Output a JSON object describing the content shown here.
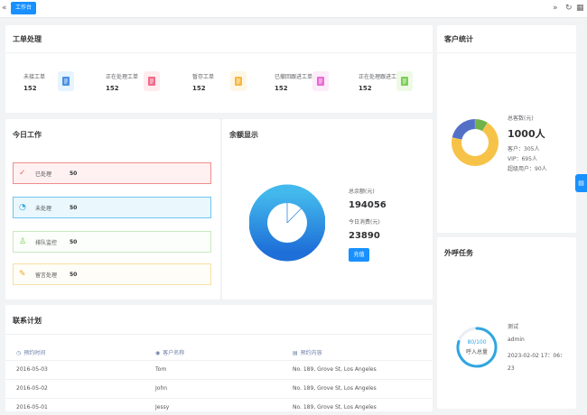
{
  "topbar": {
    "active_tab": "工作台"
  },
  "work_order": {
    "title": "工单处理",
    "items": [
      {
        "label": "未接工单",
        "value": "152",
        "color": "#4a90e2",
        "bg": "#e6f4ff"
      },
      {
        "label": "正在处理工单",
        "value": "152",
        "color": "#f06a8a",
        "bg": "#ffecef"
      },
      {
        "label": "暂存工单",
        "value": "152",
        "color": "#f5b942",
        "bg": "#fff7e6"
      },
      {
        "label": "已撤回跟进工单",
        "value": "152",
        "color": "#e86bd4",
        "bg": "#fdecfa"
      },
      {
        "label": "正在处理跟进工单",
        "value": "152",
        "color": "#7ccf55",
        "bg": "#eefae6"
      }
    ]
  },
  "customer_stats": {
    "title": "客户统计",
    "total_label": "总客数(元)",
    "total_value": "1000人",
    "lines": [
      "客户：305人",
      "VIP：695人",
      "超级用户：90人"
    ],
    "segments": [
      {
        "name": "超级用户",
        "fraction": 0.09,
        "color": "#6fb24a"
      },
      {
        "name": "VIP",
        "fraction": 0.695,
        "color": "#f7c248"
      },
      {
        "name": "客户",
        "fraction": 0.215,
        "color": "#5470c6"
      }
    ]
  },
  "today_work": {
    "title": "今日工作",
    "rows": [
      {
        "label": "已处理",
        "value": "50",
        "border": "#f08c8c",
        "bg": "#fff1f1",
        "icon": "✓",
        "icon_color": "#e06c6c"
      },
      {
        "label": "未处理",
        "value": "50",
        "border": "#6ec6f0",
        "bg": "#eaf7fd",
        "icon": "◔",
        "icon_color": "#2fa6e0"
      },
      {
        "label": "排队监控",
        "value": "50",
        "border": "#c9eac0",
        "bg": "#fbfefa",
        "icon": "♙",
        "icon_color": "#7ccf55"
      },
      {
        "label": "留言处理",
        "value": "50",
        "border": "#f7dfa4",
        "bg": "#fffdf7",
        "icon": "✎",
        "icon_color": "#f5a623"
      }
    ]
  },
  "balance": {
    "title": "余额显示",
    "total_label": "总余额(元)",
    "total_value": "194056",
    "today_label": "今日消费(元)",
    "today_value": "23890",
    "button": "充值",
    "consumed_fraction": 0.123
  },
  "outbound": {
    "title": "外呼任务",
    "ring_value": "80/100",
    "ring_label": "呼入总量",
    "progress": 0.8,
    "info": [
      "测试",
      "admin",
      "2023-02-02 17：06：",
      "23"
    ]
  },
  "contact_plan": {
    "title": "联系计划",
    "headers": [
      "预约时间",
      "客户名称",
      "预约内容"
    ],
    "rows": [
      [
        "2016-05-03",
        "Tom",
        "No. 189, Grove St, Los Angeles"
      ],
      [
        "2016-05-02",
        "John",
        "No. 189, Grove St, Los Angeles"
      ],
      [
        "2016-05-01",
        "Jessy",
        "No. 189, Grove St, Los Angeles"
      ]
    ]
  }
}
